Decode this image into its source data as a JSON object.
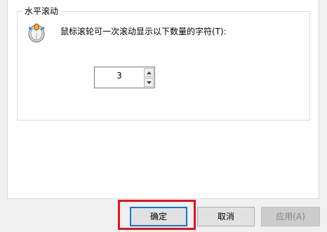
{
  "group": {
    "title": "水平滚动",
    "description": "鼠标滚轮可一次滚动显示以下数量的字符(T):"
  },
  "scroll": {
    "value": "3"
  },
  "buttons": {
    "ok": "确定",
    "cancel": "取消",
    "apply": "应用(A)"
  },
  "icons": {
    "mouse": "mouse-wheel-icon",
    "up": "spin-up-arrow-icon",
    "down": "spin-down-arrow-icon"
  },
  "colors": {
    "highlight": "#e0141e",
    "focus": "#0078d7"
  }
}
